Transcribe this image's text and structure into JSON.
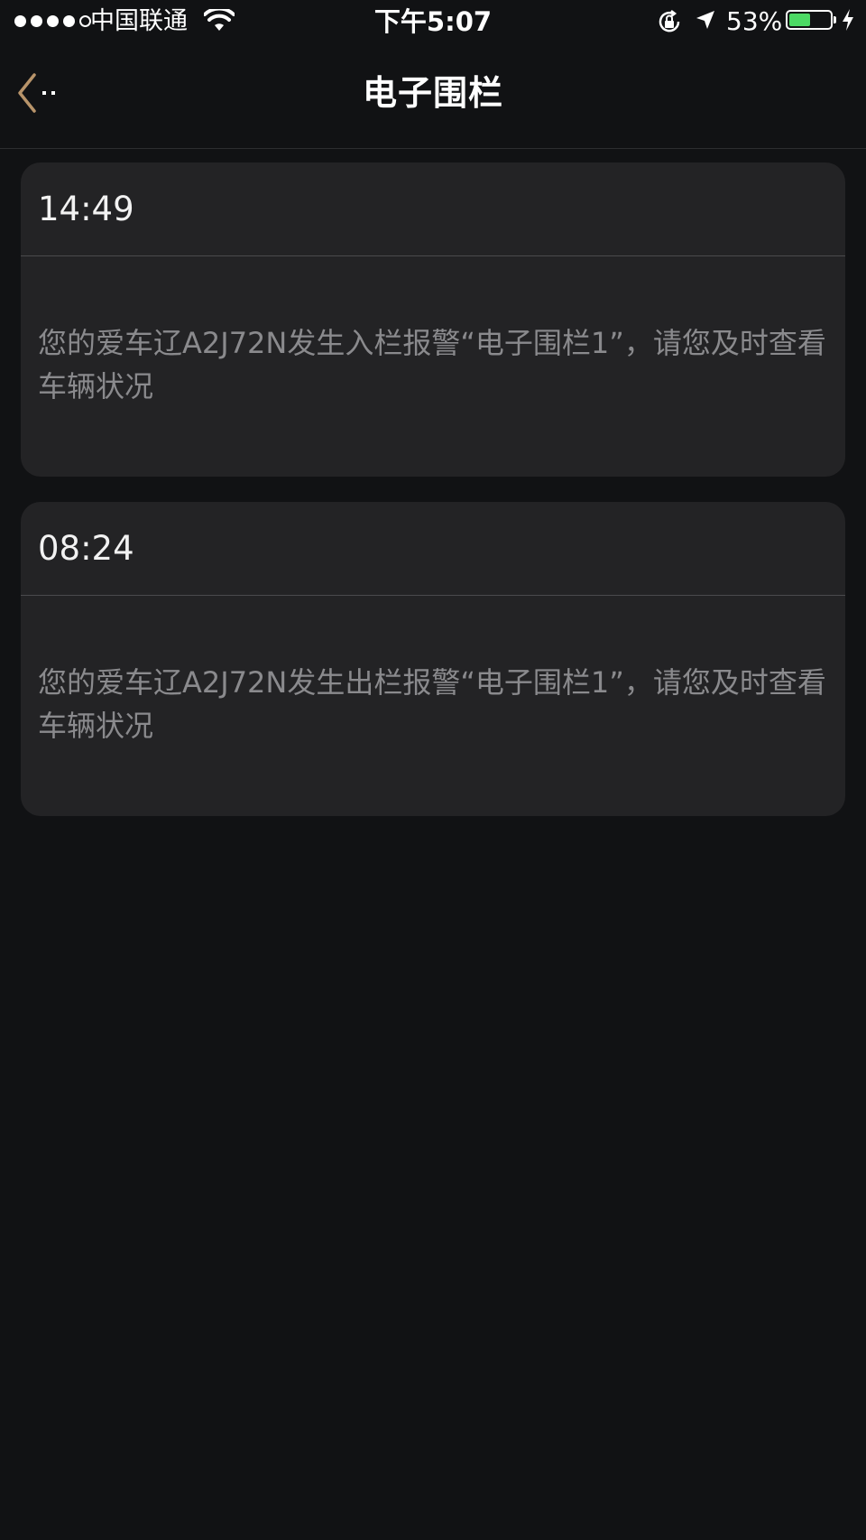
{
  "status_bar": {
    "carrier": "中国联通",
    "time": "下午5:07",
    "battery_percent": "53%",
    "battery_level": 0.53,
    "signal_bars_filled": 4,
    "signal_bars_total": 5
  },
  "header": {
    "title": "电子围栏"
  },
  "alerts": [
    {
      "time": "14:49",
      "message": "您的爱车辽A2J72N发生入栏报警“电子围栏1”，请您及时查看车辆状况"
    },
    {
      "time": "08:24",
      "message": "您的爱车辽A2J72N发生出栏报警“电子围栏1”，请您及时查看车辆状况"
    }
  ],
  "colors": {
    "background": "#111214",
    "card": "#232325",
    "accent_back": "#b8946a",
    "battery": "#4cd964",
    "message_text": "#8a8a8d"
  },
  "icons": {
    "back": "chevron-left-icon",
    "wifi": "wifi-icon",
    "lock": "rotation-lock-icon",
    "location": "location-arrow-icon",
    "battery": "battery-icon",
    "charging": "charging-bolt-icon"
  }
}
